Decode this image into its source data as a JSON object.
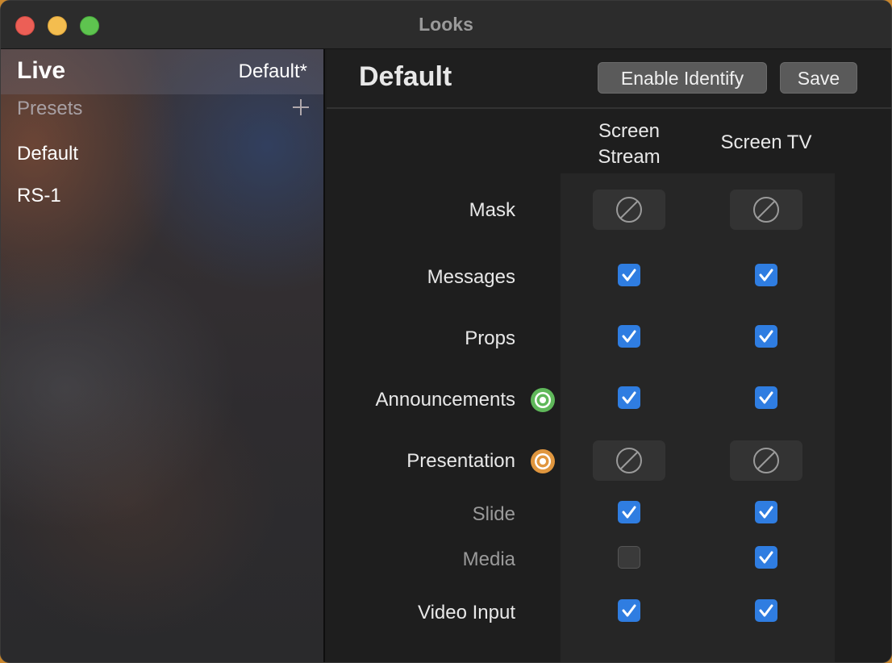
{
  "window": {
    "title": "Looks"
  },
  "sidebar": {
    "live_label": "Live",
    "live_value": "Default*",
    "presets_label": "Presets",
    "add_icon": "plus-icon",
    "presets": [
      {
        "label": "Default"
      },
      {
        "label": "RS-1"
      }
    ]
  },
  "main": {
    "title": "Default",
    "buttons": {
      "enable_identify": "Enable Identify",
      "save": "Save"
    },
    "columns": [
      {
        "label_line1": "Screen",
        "label_line2": "Stream"
      },
      {
        "label": "Screen TV"
      }
    ],
    "rows": [
      {
        "label": "Mask",
        "type": "null",
        "values": [
          null,
          null
        ]
      },
      {
        "label": "Messages",
        "type": "check",
        "values": [
          true,
          true
        ]
      },
      {
        "label": "Props",
        "type": "check",
        "values": [
          true,
          true
        ]
      },
      {
        "label": "Announcements",
        "type": "check",
        "icon": "target-icon-green",
        "values": [
          true,
          true
        ]
      },
      {
        "label": "Presentation",
        "type": "null",
        "icon": "target-icon-orange",
        "values": [
          null,
          null
        ]
      },
      {
        "label": "Slide",
        "type": "check",
        "dim": true,
        "values": [
          true,
          true
        ]
      },
      {
        "label": "Media",
        "type": "check",
        "dim": true,
        "values": [
          false,
          true
        ]
      },
      {
        "label": "Video Input",
        "type": "check",
        "values": [
          true,
          true
        ]
      }
    ]
  },
  "colors": {
    "checkbox_on": "#2f7de1",
    "announcements_icon": "#5fb85a",
    "presentation_icon": "#e0963e"
  }
}
